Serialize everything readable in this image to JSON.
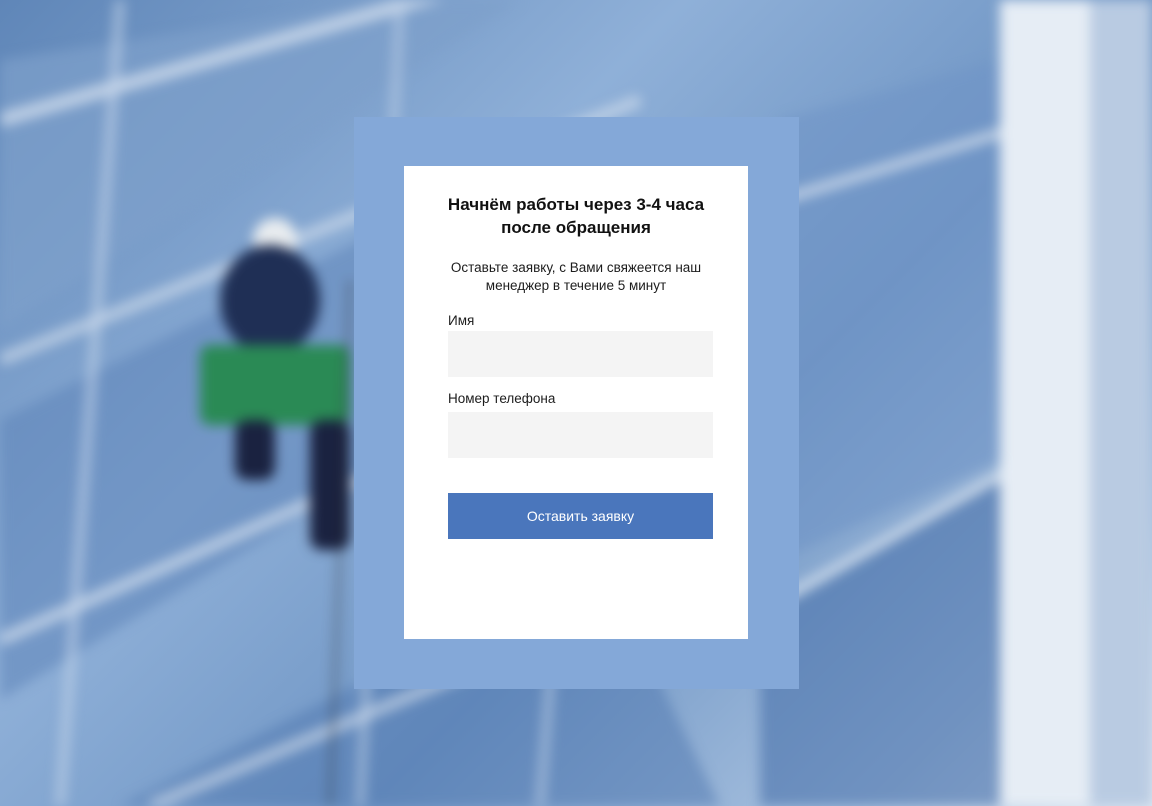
{
  "form": {
    "title": "Начнём работы через 3-4 часа после обращения",
    "subtitle": "Оставьте заявку, с Вами свяжеется наш менеджер в течение 5 минут",
    "name_label": "Имя",
    "name_value": "",
    "name_placeholder": "",
    "phone_label": "Номер телефона",
    "phone_value": "",
    "phone_placeholder": "",
    "submit_label": "Оставить заявку"
  },
  "colors": {
    "frame": "#84a8d8",
    "button": "#4a76bc",
    "input_bg": "#f4f4f4"
  }
}
